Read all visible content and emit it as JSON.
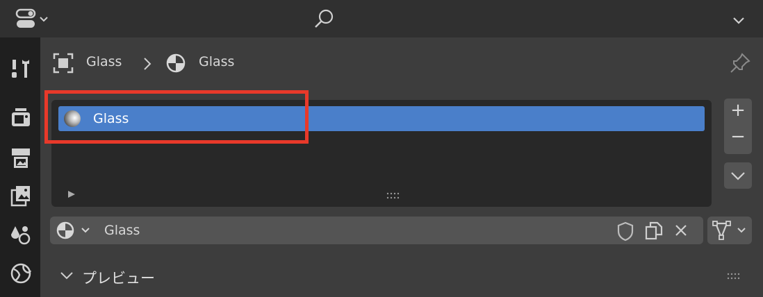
{
  "topbar": {
    "editor_type_icon": "editor-type-icon",
    "search_icon": "search-icon",
    "collapse_icon": "chevron-down-icon"
  },
  "sidebar": {
    "items": [
      {
        "name": "tool",
        "icon": "tool-wrench-screwdriver-icon"
      },
      {
        "name": "render",
        "icon": "render-camera-icon"
      },
      {
        "name": "output",
        "icon": "output-printer-icon"
      },
      {
        "name": "view-layer",
        "icon": "view-layer-images-icon"
      },
      {
        "name": "scene",
        "icon": "scene-shapes-icon"
      },
      {
        "name": "world",
        "icon": "world-globe-icon"
      }
    ]
  },
  "breadcrumb": {
    "object": "Glass",
    "separator": "›",
    "material": "Glass"
  },
  "material_slots": {
    "items": [
      {
        "label": "Glass",
        "selected": true
      }
    ],
    "add_button": "+",
    "remove_button": "−"
  },
  "material_selector": {
    "value": "Glass"
  },
  "panels": {
    "preview_label": "プレビュー"
  },
  "colors": {
    "selection": "#4a7fca",
    "highlight_box": "#e8392a"
  }
}
